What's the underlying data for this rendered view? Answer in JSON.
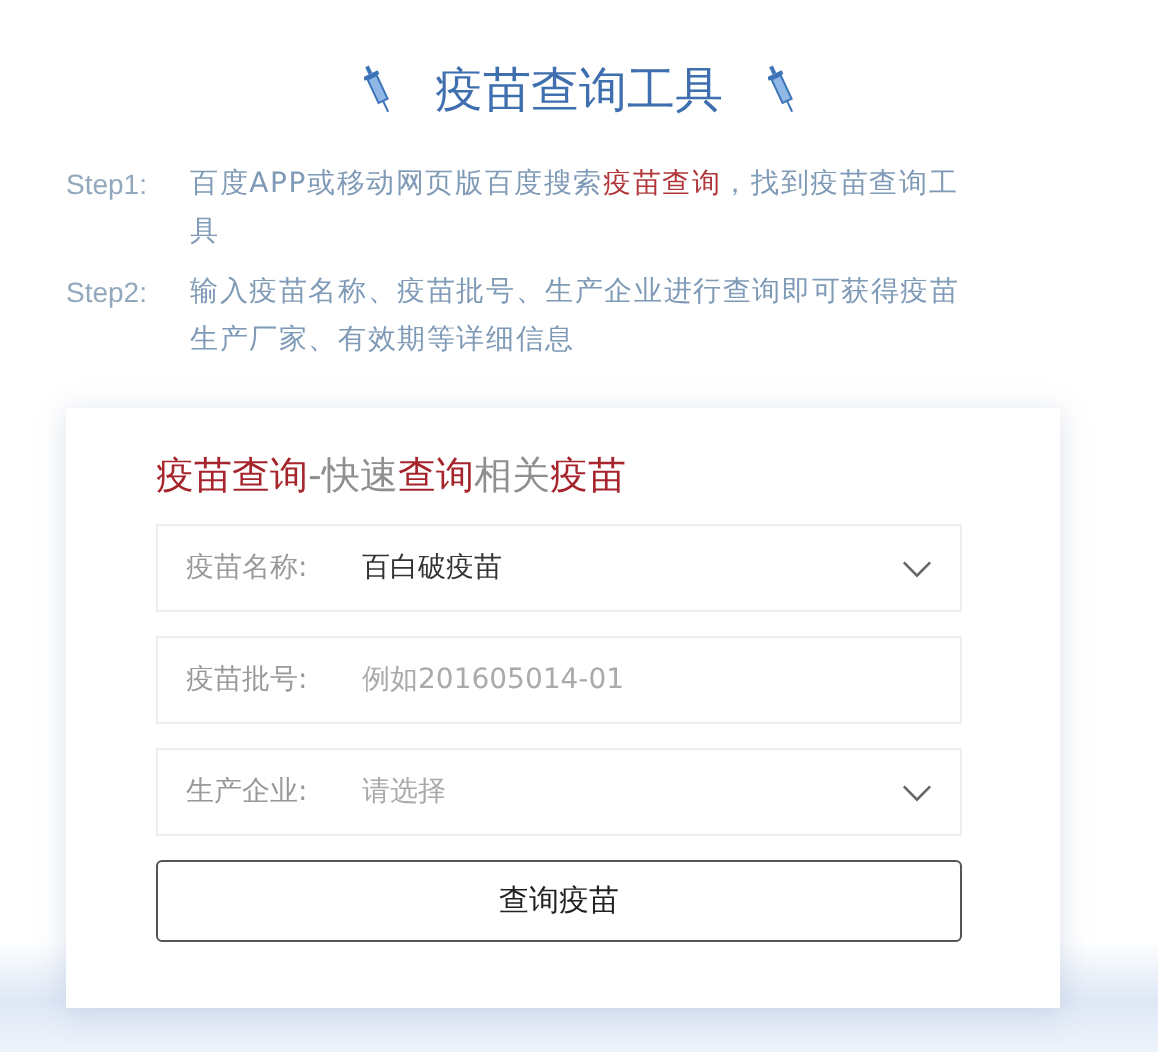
{
  "header": {
    "title": "疫苗查询工具"
  },
  "steps": [
    {
      "label": "Step1:",
      "segments": [
        {
          "text": "百度APP或移动网页版百度搜索",
          "highlight": false
        },
        {
          "text": "疫苗查询",
          "highlight": true
        },
        {
          "text": "，找到疫苗查询工具",
          "highlight": false
        }
      ]
    },
    {
      "label": "Step2:",
      "segments": [
        {
          "text": "输入疫苗名称、疫苗批号、生产企业进行查询即可获得疫苗生产厂家、有效期等详细信息",
          "highlight": false
        }
      ]
    }
  ],
  "card": {
    "title_segments": [
      {
        "text": "疫苗查询",
        "highlight": true
      },
      {
        "text": "-快速",
        "highlight": false
      },
      {
        "text": "查询",
        "highlight": true
      },
      {
        "text": "相关",
        "highlight": false
      },
      {
        "text": "疫苗",
        "highlight": true
      }
    ],
    "fields": [
      {
        "kind": "select",
        "label": "疫苗名称:",
        "value": "百白破疫苗"
      },
      {
        "kind": "input",
        "label": "疫苗批号:",
        "placeholder": "例如201605014-01"
      },
      {
        "kind": "select",
        "label": "生产企业:",
        "placeholder": "请选择"
      }
    ],
    "button": "查询疫苗"
  }
}
